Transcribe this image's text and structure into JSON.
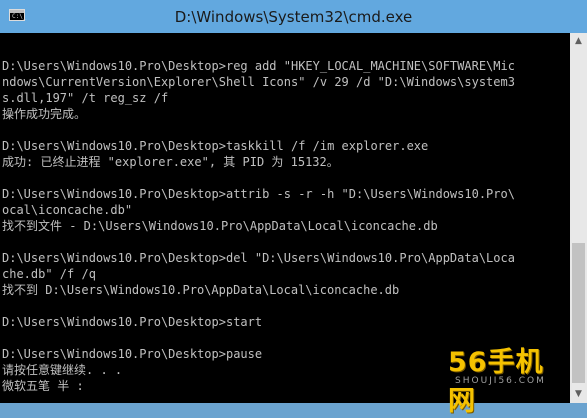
{
  "window": {
    "title": "D:\\Windows\\System32\\cmd.exe",
    "icon": "cmd-icon",
    "icon_prompt": "C:\\_"
  },
  "console": {
    "lines": [
      "",
      "D:\\Users\\Windows10.Pro\\Desktop>reg add \"HKEY_LOCAL_MACHINE\\SOFTWARE\\Mic",
      "ndows\\CurrentVersion\\Explorer\\Shell Icons\" /v 29 /d \"D:\\Windows\\system3",
      "s.dll,197\" /t reg_sz /f",
      "操作成功完成。",
      "",
      "D:\\Users\\Windows10.Pro\\Desktop>taskkill /f /im explorer.exe",
      "成功: 已终止进程 \"explorer.exe\", 其 PID 为 15132。",
      "",
      "D:\\Users\\Windows10.Pro\\Desktop>attrib -s -r -h \"D:\\Users\\Windows10.Pro\\",
      "ocal\\iconcache.db\"",
      "找不到文件 - D:\\Users\\Windows10.Pro\\AppData\\Local\\iconcache.db",
      "",
      "D:\\Users\\Windows10.Pro\\Desktop>del \"D:\\Users\\Windows10.Pro\\AppData\\Loca",
      "che.db\" /f /q",
      "找不到 D:\\Users\\Windows10.Pro\\AppData\\Local\\iconcache.db",
      "",
      "D:\\Users\\Windows10.Pro\\Desktop>start",
      "",
      "D:\\Users\\Windows10.Pro\\Desktop>pause",
      "请按任意键继续. . .",
      "微软五笔 半 :"
    ]
  },
  "scrollbar": {
    "up_icon": "scroll-up-arrow-icon",
    "down_icon": "scroll-down-arrow-icon",
    "up_glyph": "▲",
    "down_glyph": "▼"
  },
  "watermark": {
    "logo_text": "56手机网",
    "sub_text": "SHOUJI56.COM",
    "color": "#f5c200"
  },
  "colors": {
    "console_bg": "#000000",
    "console_fg": "#c0c0c0",
    "titlebar": "#62a8df"
  }
}
